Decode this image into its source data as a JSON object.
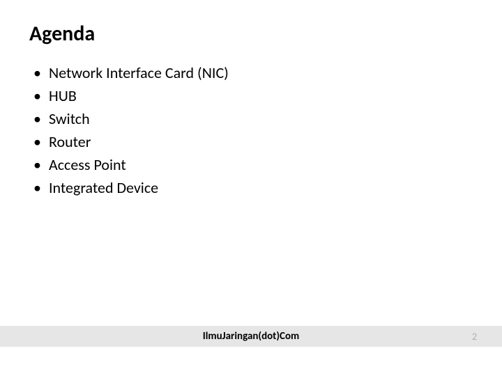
{
  "title": "Agenda",
  "bullets": [
    "Network Interface Card (NIC)",
    "HUB",
    "Switch",
    "Router",
    "Access Point",
    "Integrated Device"
  ],
  "footer": "IlmuJaringan(dot)Com",
  "page_number": "2"
}
